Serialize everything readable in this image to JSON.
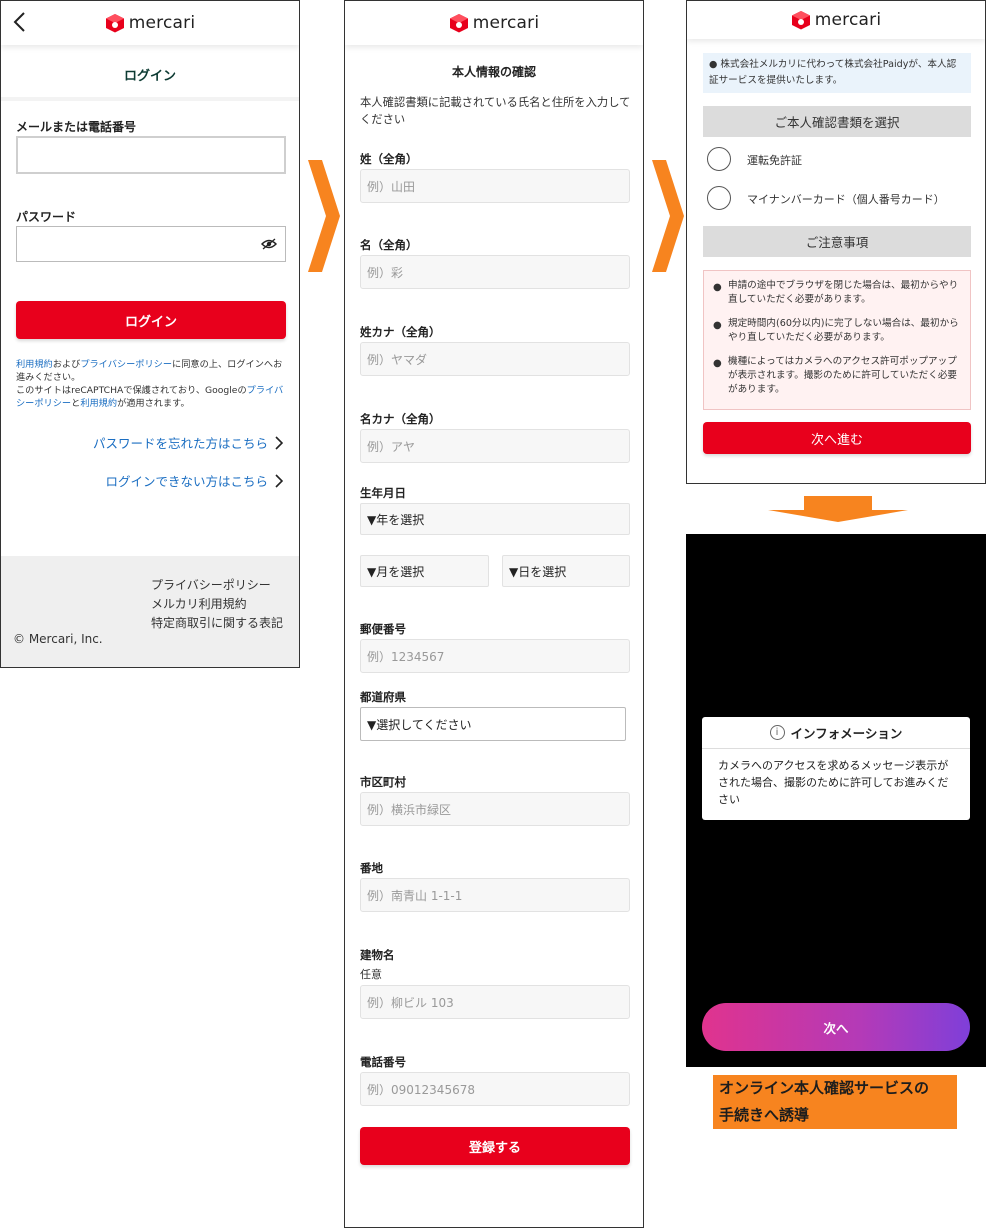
{
  "brand": {
    "name": "mercari",
    "red": "#e8001c",
    "blue": "#1b6ec2",
    "arrow_orange": "#f7841f"
  },
  "login": {
    "title": "ログイン",
    "email_label": "メールまたは電話番号",
    "password_label": "パスワード",
    "submit": "ログイン",
    "note": {
      "terms": "利用規約",
      "and": "および",
      "privacy": "プライバシーポリシー",
      "agree": "に同意の上、ログインへお進みください。",
      "recaptcha": "このサイトはreCAPTCHAで保護されており、Googleの",
      "privacy2": "プライバシーポリシー",
      "to": "と",
      "terms2": "利用規約",
      "applies": "が適用されます。"
    },
    "forgot_password": "パスワードを忘れた方はこちら",
    "cannot_login": "ログインできない方はこちら",
    "footer": {
      "links": [
        "プライバシーポリシー",
        "メルカリ利用規約",
        "特定商取引に関する表記"
      ],
      "copyright": "© Mercari, Inc."
    }
  },
  "profile": {
    "title": "本人情報の確認",
    "description": "本人確認書類に記載されている氏名と住所を入力してください",
    "fields": {
      "last_name": {
        "label": "姓（全角）",
        "placeholder": "例）山田"
      },
      "first_name": {
        "label": "名（全角）",
        "placeholder": "例）彩"
      },
      "last_kana": {
        "label": "姓カナ（全角）",
        "placeholder": "例）ヤマダ"
      },
      "first_kana": {
        "label": "名カナ（全角）",
        "placeholder": "例）アヤ"
      },
      "birthday": {
        "label": "生年月日",
        "year": "▼年を選択",
        "month": "▼月を選択",
        "day": "▼日を選択"
      },
      "postal": {
        "label": "郵便番号",
        "placeholder": "例）1234567"
      },
      "prefecture": {
        "label": "都道府県",
        "value": "▼選択してください"
      },
      "city": {
        "label": "市区町村",
        "placeholder": "例）横浜市緑区"
      },
      "address": {
        "label": "番地",
        "placeholder": "例）南青山 1-1-1"
      },
      "building": {
        "label": "建物名",
        "sublabel": "任意",
        "placeholder": "例）柳ビル 103"
      },
      "phone": {
        "label": "電話番号",
        "placeholder": "例）09012345678"
      }
    },
    "submit": "登録する"
  },
  "id_select": {
    "info": "● 株式会社メルカリに代わって株式会社Paidyが、本人認証サービスを提供いたします。",
    "select_header": "ご本人確認書類を選択",
    "options": [
      "運転免許証",
      "マイナンバーカード（個人番号カード）"
    ],
    "notice_header": "ご注意事項",
    "notices": [
      "申請の途中でブラウザを閉じた場合は、最初からやり直していただく必要があります。",
      "規定時間内(60分以内)に完了しない場合は、最初からやり直していただく必要があります。",
      "機種によってはカメラへのアクセス許可ポップアップが表示されます。撮影のために許可していただく必要があります。"
    ],
    "next": "次へ進む"
  },
  "camera": {
    "dialog_title": "インフォメーション",
    "info_glyph": "i",
    "dialog_body": "カメラへのアクセスを求めるメッセージ表示がされた場合、撮影のために許可してお進みください",
    "next": "次へ"
  },
  "caption": {
    "line1": "オンライン本人確認サービスの",
    "line2": "手続きへ誘導"
  }
}
